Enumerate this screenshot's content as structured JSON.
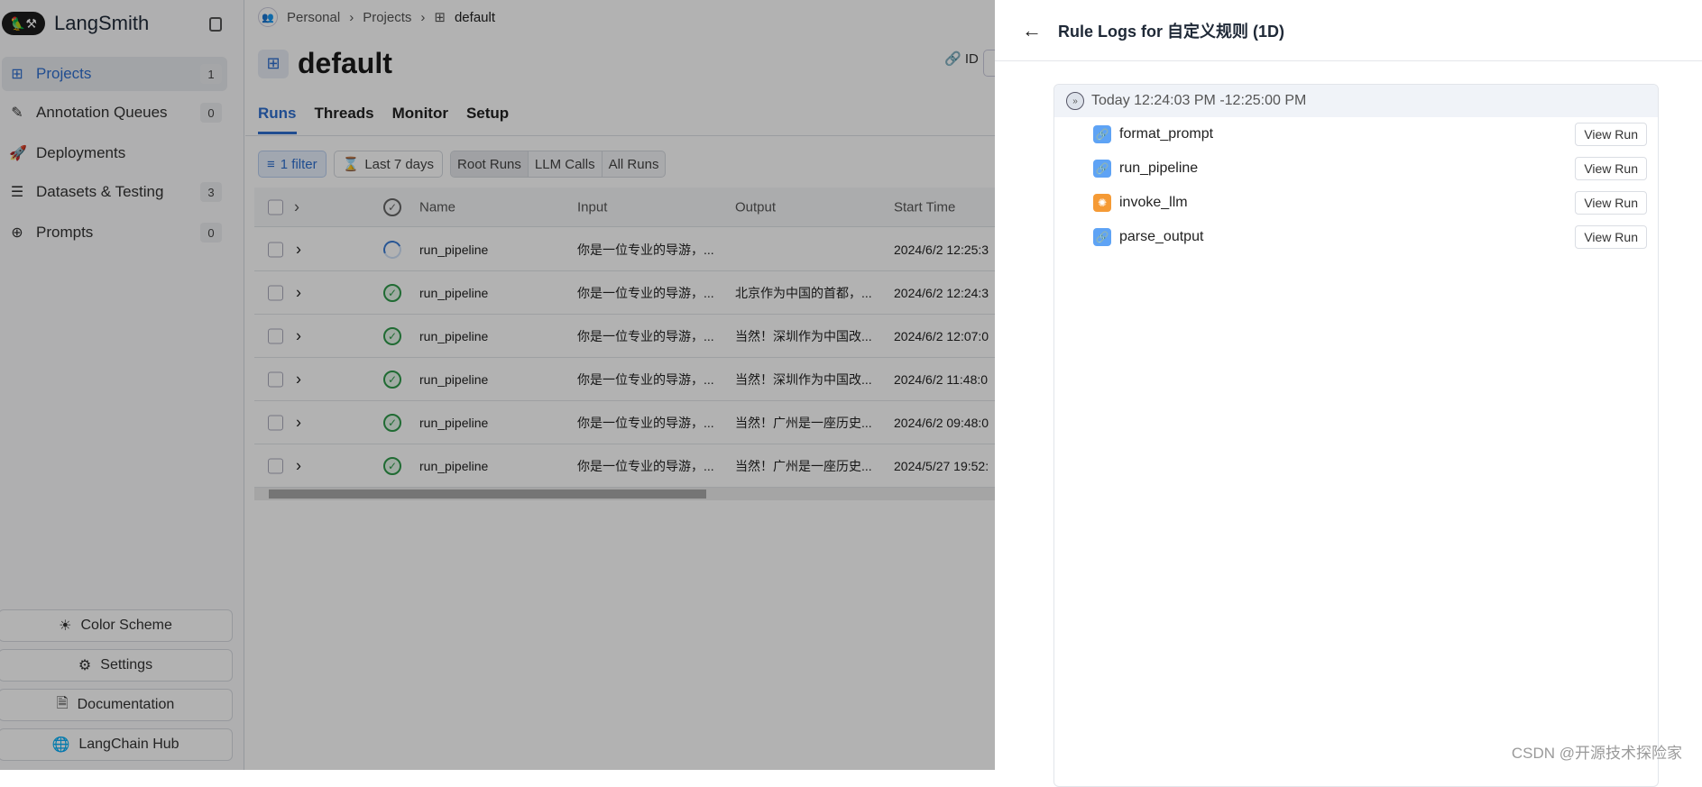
{
  "sidebar": {
    "brand": "LangSmith",
    "items": [
      {
        "label": "Projects",
        "badge": "1",
        "icon": "grid-icon"
      },
      {
        "label": "Annotation Queues",
        "badge": "0",
        "icon": "pen-icon"
      },
      {
        "label": "Deployments",
        "badge": null,
        "icon": "rocket-icon"
      },
      {
        "label": "Datasets & Testing",
        "badge": "3",
        "icon": "database-icon"
      },
      {
        "label": "Prompts",
        "badge": "0",
        "icon": "chat-plus-icon"
      }
    ],
    "bottom": [
      {
        "label": "Color Scheme",
        "icon": "sun-icon"
      },
      {
        "label": "Settings",
        "icon": "gear-icon"
      },
      {
        "label": "Documentation",
        "icon": "document-icon"
      },
      {
        "label": "LangChain Hub",
        "icon": "globe-icon"
      }
    ]
  },
  "breadcrumb": [
    "Personal",
    "Projects",
    "default"
  ],
  "page_title": "default",
  "id_label": "ID",
  "tabs": [
    "Runs",
    "Threads",
    "Monitor",
    "Setup"
  ],
  "filters": {
    "filter": "1 filter",
    "range": "Last 7 days",
    "segments": [
      "Root Runs",
      "LLM Calls",
      "All Runs"
    ]
  },
  "table": {
    "columns": [
      "Name",
      "Input",
      "Output",
      "Start Time"
    ],
    "rows": [
      {
        "status": "running",
        "name": "run_pipeline",
        "input": "你是一位专业的导游，...",
        "output": "",
        "start": "2024/6/2 12:25:3"
      },
      {
        "status": "success",
        "name": "run_pipeline",
        "input": "你是一位专业的导游，...",
        "output": "北京作为中国的首都，...",
        "start": "2024/6/2 12:24:3"
      },
      {
        "status": "success",
        "name": "run_pipeline",
        "input": "你是一位专业的导游，...",
        "output": "当然！深圳作为中国改...",
        "start": "2024/6/2 12:07:0"
      },
      {
        "status": "success",
        "name": "run_pipeline",
        "input": "你是一位专业的导游，...",
        "output": "当然！深圳作为中国改...",
        "start": "2024/6/2 11:48:0"
      },
      {
        "status": "success",
        "name": "run_pipeline",
        "input": "你是一位专业的导游，...",
        "output": "当然！广州是一座历史...",
        "start": "2024/6/2 09:48:0"
      },
      {
        "status": "success",
        "name": "run_pipeline",
        "input": "你是一位专业的导游，...",
        "output": "当然！广州是一座历史...",
        "start": "2024/5/27 19:52:"
      }
    ]
  },
  "panel": {
    "title": "Rule Logs for 自定义规则 (1D)",
    "group": "Today 12:24:03 PM -12:25:00 PM",
    "items": [
      {
        "name": "format_prompt",
        "type": "chain",
        "color": "#5ea3f5",
        "button": "View Run"
      },
      {
        "name": "run_pipeline",
        "type": "chain",
        "color": "#5ea3f5",
        "button": "View Run"
      },
      {
        "name": "invoke_llm",
        "type": "llm",
        "color": "#f59a35",
        "button": "View Run"
      },
      {
        "name": "parse_output",
        "type": "chain",
        "color": "#5ea3f5",
        "button": "View Run"
      }
    ]
  },
  "watermark": "CSDN @开源技术探险家",
  "colors": {
    "accent": "#2f6fcf",
    "success": "#2e9a4a",
    "chain": "#5ea3f5",
    "llm": "#f59a35"
  }
}
